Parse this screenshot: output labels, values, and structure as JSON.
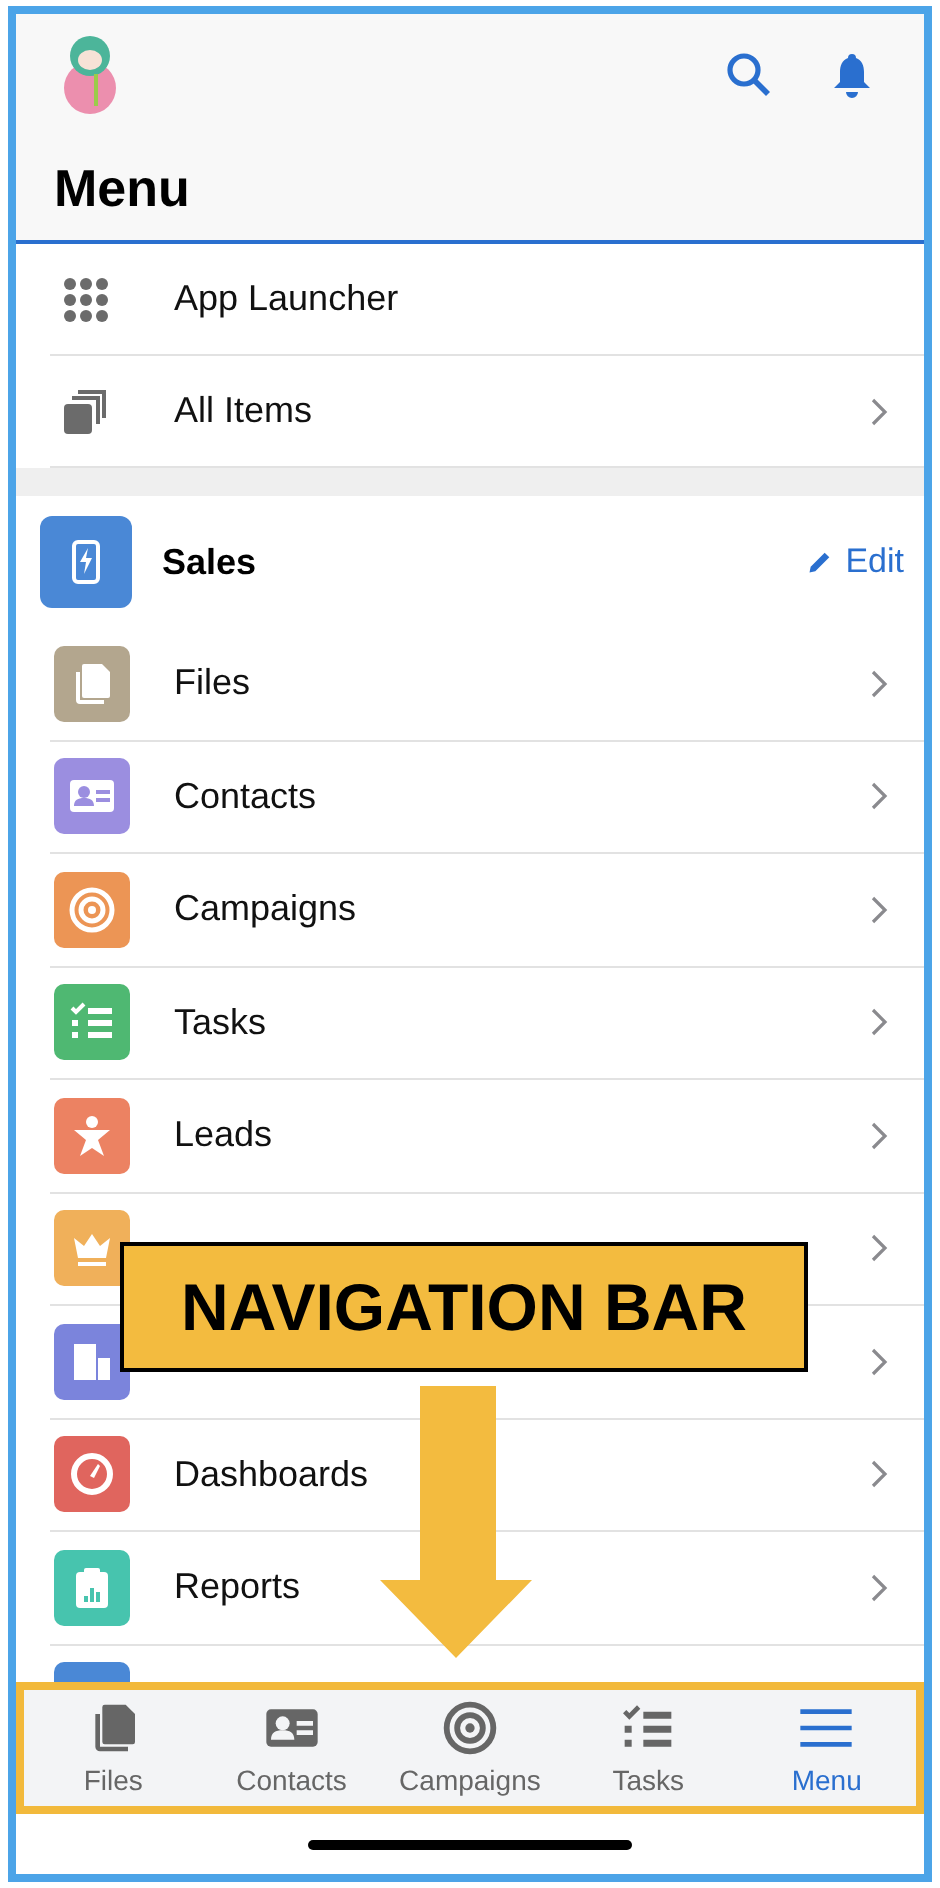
{
  "header": {
    "title": "Menu"
  },
  "top_items": [
    {
      "label": "App Launcher",
      "kind": "grid",
      "chevron": false
    },
    {
      "label": "All Items",
      "kind": "stack",
      "chevron": true
    }
  ],
  "app": {
    "name": "Sales",
    "edit_label": "Edit",
    "color": "#4a88d6"
  },
  "items": [
    {
      "label": "Files",
      "kind": "files",
      "color": "#b3a68e",
      "chevron": true
    },
    {
      "label": "Contacts",
      "kind": "card",
      "color": "#9b8ee0",
      "chevron": true
    },
    {
      "label": "Campaigns",
      "kind": "target",
      "color": "#ec9555",
      "chevron": true
    },
    {
      "label": "Tasks",
      "kind": "tasks",
      "color": "#4fb872",
      "chevron": true
    },
    {
      "label": "Leads",
      "kind": "person",
      "color": "#ec8262",
      "chevron": true
    },
    {
      "kind": "crown",
      "color": "#f0b05a",
      "chevron": true
    },
    {
      "kind": "building",
      "color": "#7b84dc",
      "chevron": true
    },
    {
      "label": "Dashboards",
      "kind": "gauge",
      "color": "#e0655e",
      "chevron": true
    },
    {
      "label": "Reports",
      "kind": "report",
      "color": "#47c4ae",
      "chevron": true
    },
    {
      "kind": "blank",
      "color": "#4a88d6"
    }
  ],
  "callout": {
    "text": "NAVIGATION BAR"
  },
  "nav": [
    {
      "label": "Files",
      "kind": "files",
      "selected": false
    },
    {
      "label": "Contacts",
      "kind": "card",
      "selected": false
    },
    {
      "label": "Campaigns",
      "kind": "target",
      "selected": false
    },
    {
      "label": "Tasks",
      "kind": "tasks",
      "selected": false
    },
    {
      "label": "Menu",
      "kind": "menu",
      "selected": true
    }
  ]
}
